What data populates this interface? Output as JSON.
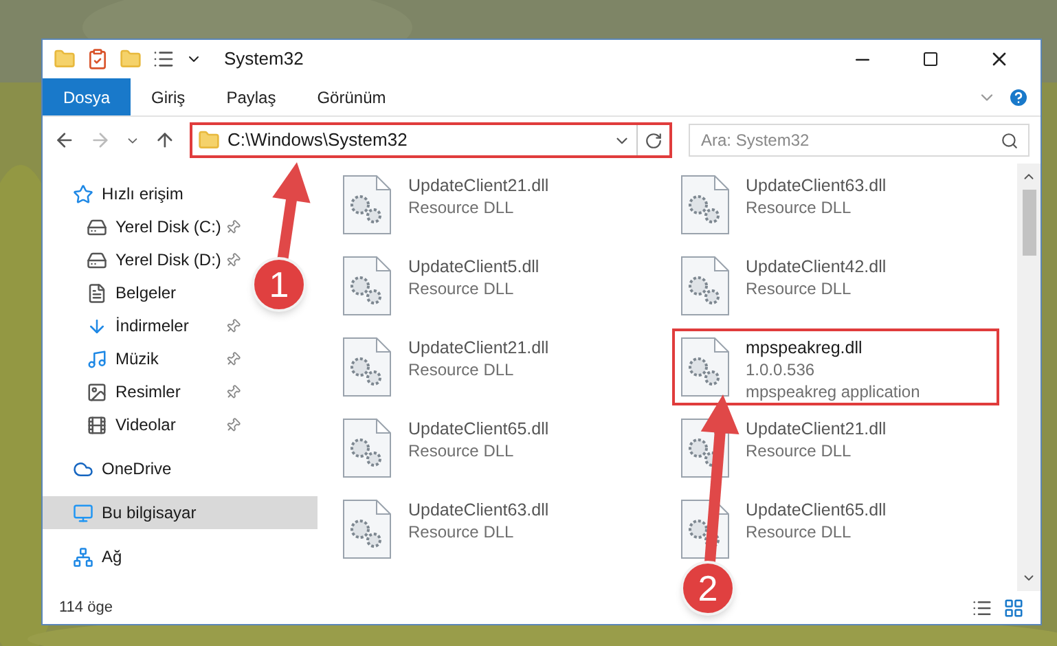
{
  "window": {
    "title": "System32"
  },
  "ribbon_tabs": [
    {
      "label": "Dosya",
      "selected": true
    },
    {
      "label": "Giriş",
      "selected": false
    },
    {
      "label": "Paylaş",
      "selected": false
    },
    {
      "label": "Görünüm",
      "selected": false
    }
  ],
  "address_bar": {
    "path": "C:\\Windows\\System32",
    "highlighted": true
  },
  "search": {
    "placeholder": "Ara: System32"
  },
  "sidebar": {
    "items": [
      {
        "label": "Hızlı erişim",
        "selected": false,
        "children": [
          {
            "label": "Yerel Disk (C:)",
            "pinned": true,
            "selected": false
          },
          {
            "label": "Yerel Disk (D:)",
            "pinned": true,
            "selected": false
          },
          {
            "label": "Belgeler",
            "pinned": false,
            "selected": false
          },
          {
            "label": "İndirmeler",
            "pinned": true,
            "selected": false
          },
          {
            "label": "Müzik",
            "pinned": true,
            "selected": false
          },
          {
            "label": "Resimler",
            "pinned": true,
            "selected": false
          },
          {
            "label": "Videolar",
            "pinned": true,
            "selected": false
          }
        ]
      },
      {
        "label": "OneDrive",
        "selected": false
      },
      {
        "label": "Bu bilgisayar",
        "selected": true
      },
      {
        "label": "Ağ",
        "selected": false
      }
    ]
  },
  "files": [
    {
      "name": "UpdateClient21.dll",
      "lines": [
        "Resource DLL"
      ],
      "highlighted": false
    },
    {
      "name": "UpdateClient63.dll",
      "lines": [
        "Resource DLL"
      ],
      "highlighted": false
    },
    {
      "name": "UpdateClient5.dll",
      "lines": [
        "Resource DLL"
      ],
      "highlighted": false
    },
    {
      "name": "UpdateClient42.dll",
      "lines": [
        "Resource DLL"
      ],
      "highlighted": false
    },
    {
      "name": "UpdateClient21.dll",
      "lines": [
        "Resource DLL"
      ],
      "highlighted": false
    },
    {
      "name": "mpspeakreg.dll",
      "lines": [
        "1.0.0.536",
        "mpspeakreg application"
      ],
      "highlighted": true
    },
    {
      "name": "UpdateClient65.dll",
      "lines": [
        "Resource DLL"
      ],
      "highlighted": false
    },
    {
      "name": "UpdateClient21.dll",
      "lines": [
        "Resource DLL"
      ],
      "highlighted": false
    },
    {
      "name": "UpdateClient63.dll",
      "lines": [
        "Resource DLL"
      ],
      "highlighted": false
    },
    {
      "name": "UpdateClient65.dll",
      "lines": [
        "Resource DLL"
      ],
      "highlighted": false
    }
  ],
  "status_bar": {
    "count": "114 öge"
  },
  "annotations": [
    {
      "number": "1"
    },
    {
      "number": "2"
    }
  ]
}
